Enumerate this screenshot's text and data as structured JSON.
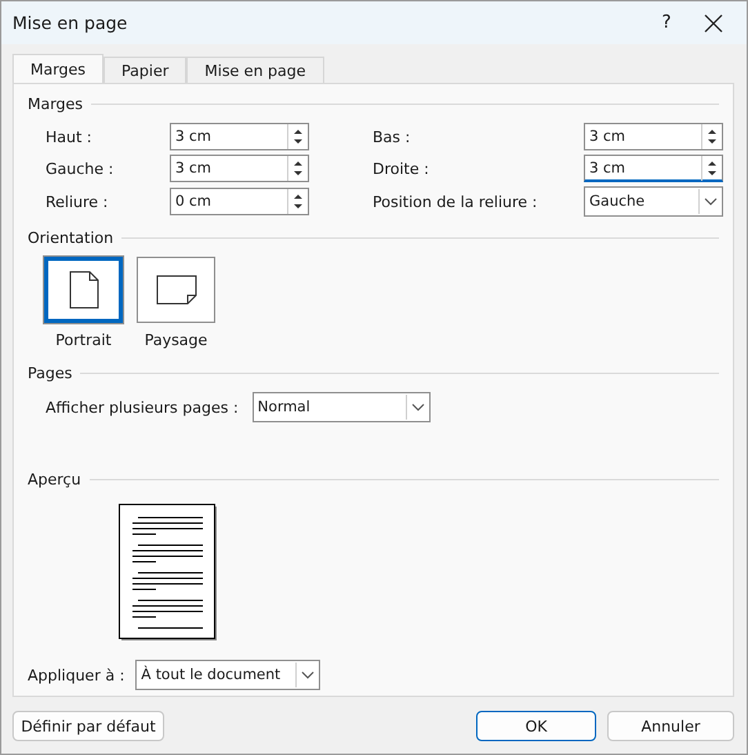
{
  "window": {
    "title": "Mise en page",
    "help": "?"
  },
  "tabs": [
    {
      "label": "Marges",
      "selected": true
    },
    {
      "label": "Papier",
      "selected": false
    },
    {
      "label": "Mise en page",
      "selected": false
    }
  ],
  "margins": {
    "heading": "Marges",
    "fields": [
      {
        "label": "Haut :",
        "value": "3 cm",
        "kind": "spin",
        "focused": false
      },
      {
        "label": "Bas :",
        "value": "3 cm",
        "kind": "spin",
        "focused": false
      },
      {
        "label": "Gauche :",
        "value": "3 cm",
        "kind": "spin",
        "focused": false
      },
      {
        "label": "Droite :",
        "value": "3 cm",
        "kind": "spin",
        "focused": true
      },
      {
        "label": "Reliure :",
        "value": "0 cm",
        "kind": "spin",
        "focused": false
      },
      {
        "label": "Position de la reliure :",
        "value": "Gauche",
        "kind": "select",
        "focused": false
      }
    ]
  },
  "orientation": {
    "heading": "Orientation",
    "options": [
      {
        "label": "Portrait",
        "kind": "portrait",
        "selected": true
      },
      {
        "label": "Paysage",
        "kind": "landscape",
        "selected": false
      }
    ]
  },
  "pages": {
    "heading": "Pages",
    "label": "Afficher plusieurs pages :",
    "value": "Normal"
  },
  "preview": {
    "heading": "Aperçu"
  },
  "apply": {
    "label": "Appliquer à :",
    "value": "À tout le document"
  },
  "buttons": [
    {
      "label": "Définir par défaut",
      "kind": "normal"
    },
    {
      "label": "OK",
      "kind": "primary"
    },
    {
      "label": "Annuler",
      "kind": "normal"
    }
  ]
}
